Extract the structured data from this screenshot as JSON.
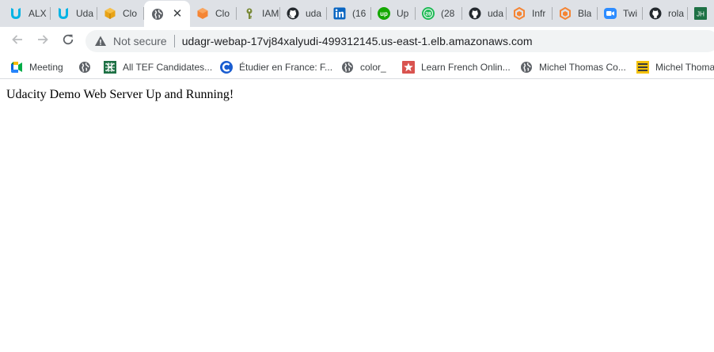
{
  "tabs": [
    {
      "title": "ALX",
      "icon": "udacity-icon"
    },
    {
      "title": "Uda",
      "icon": "udacity-icon"
    },
    {
      "title": "Clo",
      "icon": "aws-cube-icon"
    },
    {
      "title": "",
      "icon": "globe-icon",
      "active": true
    },
    {
      "title": "Clo",
      "icon": "aws-orange-icon"
    },
    {
      "title": "IAM",
      "icon": "key-icon"
    },
    {
      "title": "uda",
      "icon": "github-icon"
    },
    {
      "title": "(16",
      "icon": "linkedin-icon"
    },
    {
      "title": "Up",
      "icon": "upwork-icon"
    },
    {
      "title": "(28",
      "icon": "badge-28-icon"
    },
    {
      "title": "uda",
      "icon": "github-icon"
    },
    {
      "title": "Infr",
      "icon": "aws-orange-outline-icon"
    },
    {
      "title": "Bla",
      "icon": "aws-orange-outline-icon"
    },
    {
      "title": "Twi",
      "icon": "zoom-icon"
    },
    {
      "title": "rola",
      "icon": "github-icon"
    },
    {
      "title": "JH",
      "icon": "jh-icon"
    }
  ],
  "toolbar": {
    "back_icon": "back-arrow-icon",
    "forward_icon": "forward-arrow-icon",
    "reload_icon": "reload-icon"
  },
  "omnibox": {
    "security_label": "Not secure",
    "url": "udagr-webap-17vj84xalyudi-499312145.us-east-1.elb.amazonaws.com"
  },
  "bookmarks": [
    {
      "label": "Meeting",
      "icon": "google-meet-icon"
    },
    {
      "label": "",
      "icon": "globe-icon"
    },
    {
      "label": "All TEF Candidates...",
      "icon": "spreadsheet-icon"
    },
    {
      "label": "Étudier en France: F...",
      "icon": "campus-france-icon"
    },
    {
      "label": "color_",
      "icon": "globe-icon"
    },
    {
      "label": "Learn French Onlin...",
      "icon": "star-icon"
    },
    {
      "label": "Michel Thomas Co...",
      "icon": "globe-icon"
    },
    {
      "label": "Michel Thoma",
      "icon": "michel-thomas-icon"
    }
  ],
  "page": {
    "text": "Udacity Demo Web Server Up and Running!"
  },
  "colors": {
    "tabstrip_bg": "#dee1e6",
    "omnibox_bg": "#f1f3f4",
    "udacity": "#02b3e4",
    "aws_orange": "#ff9900",
    "linkedin": "#0a66c2",
    "upwork": "#14a800"
  }
}
